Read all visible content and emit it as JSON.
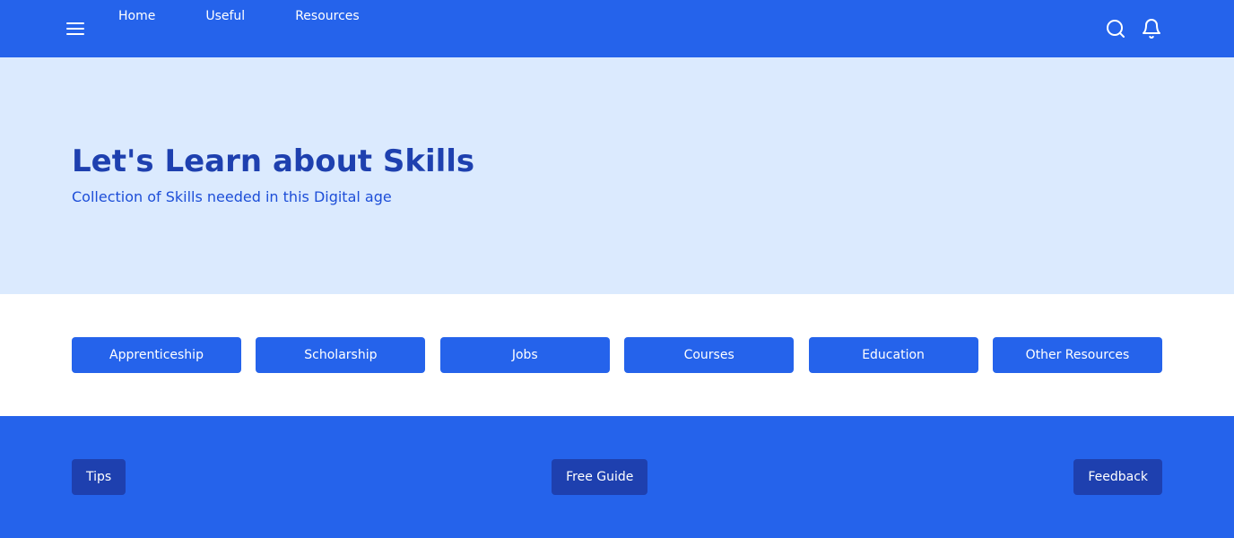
{
  "colors": {
    "primary": "#2563eb",
    "primary_dark": "#1e40af",
    "hero_background": "#dbeafe",
    "hero_subtitle": "#1d4ed8",
    "text_on_primary": "#ffffff"
  },
  "header": {
    "menu_icon": "hamburger-menu-icon",
    "nav": [
      {
        "label": "Home"
      },
      {
        "label": "Useful"
      },
      {
        "label": "Resources"
      }
    ],
    "search_icon": "search-icon",
    "notifications_icon": "bell-icon"
  },
  "hero": {
    "title": "Let's Learn about Skills",
    "subtitle": "Collection of Skills needed in this Digital age"
  },
  "categories": [
    {
      "label": "Apprenticeship"
    },
    {
      "label": "Scholarship"
    },
    {
      "label": "Jobs"
    },
    {
      "label": "Courses"
    },
    {
      "label": "Education"
    },
    {
      "label": "Other Resources"
    }
  ],
  "footer": {
    "buttons": [
      {
        "label": "Tips"
      },
      {
        "label": "Free Guide"
      },
      {
        "label": "Feedback"
      }
    ]
  }
}
